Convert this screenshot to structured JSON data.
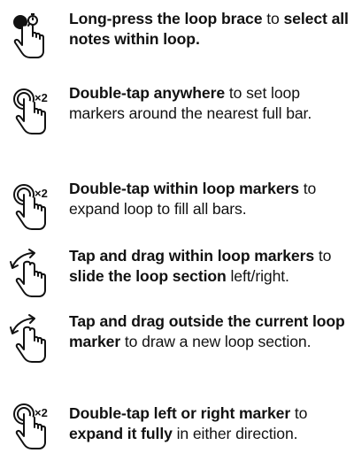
{
  "instructions": [
    {
      "icon": "long-press-timer-icon",
      "segments": [
        {
          "text": "Long-press the loop brace",
          "bold": true
        },
        {
          "text": " to ",
          "bold": false
        },
        {
          "text": "select all notes within loop.",
          "bold": true
        }
      ]
    },
    {
      "icon": "double-tap-icon",
      "badge": "×2",
      "segments": [
        {
          "text": "Double-tap anywhere",
          "bold": true
        },
        {
          "text": " to set loop markers around the nearest full bar.",
          "bold": false
        }
      ]
    },
    {
      "icon": "double-tap-icon",
      "badge": "×2",
      "segments": [
        {
          "text": "Double-tap within loop markers",
          "bold": true
        },
        {
          "text": " to expand loop to fill all bars.",
          "bold": false
        }
      ]
    },
    {
      "icon": "tap-drag-icon",
      "segments": [
        {
          "text": "Tap and drag within loop markers",
          "bold": true
        },
        {
          "text": " to ",
          "bold": false
        },
        {
          "text": "slide the loop section",
          "bold": true
        },
        {
          "text": " left/right.",
          "bold": false
        }
      ]
    },
    {
      "icon": "tap-drag-icon",
      "segments": [
        {
          "text": "Tap and drag outside the current loop marker",
          "bold": true
        },
        {
          "text": " to draw a new loop section.",
          "bold": false
        }
      ]
    },
    {
      "icon": "double-tap-icon",
      "badge": "×2",
      "segments": [
        {
          "text": "Double-tap left or right marker",
          "bold": true
        },
        {
          "text": " to ",
          "bold": false
        },
        {
          "text": "expand it fully",
          "bold": true
        },
        {
          "text": " in either direction.",
          "bold": false
        }
      ]
    }
  ]
}
